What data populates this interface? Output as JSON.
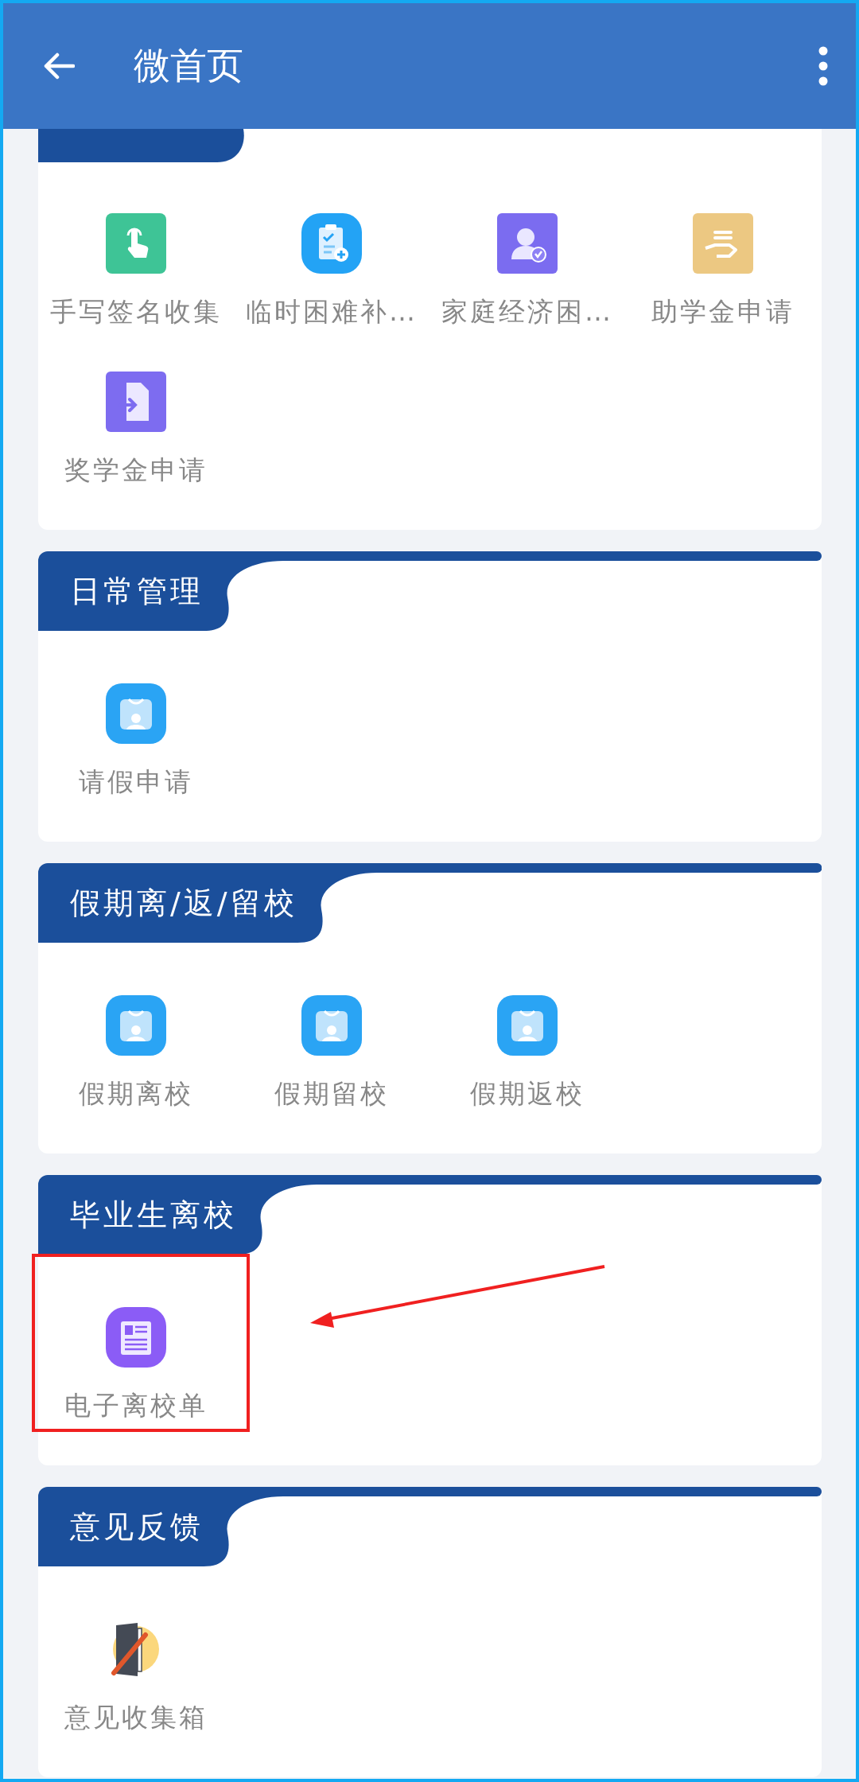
{
  "app_bar": {
    "title": "微首页"
  },
  "sections": [
    {
      "items": [
        {
          "label": "手写签名收集",
          "kind": "touch"
        },
        {
          "label": "临时困难补…",
          "kind": "clipboard"
        },
        {
          "label": "家庭经济困…",
          "kind": "user-check"
        },
        {
          "label": "助学金申请",
          "kind": "hand"
        },
        {
          "label": "奖学金申请",
          "kind": "file-arrow"
        }
      ]
    },
    {
      "title": "日常管理",
      "items": [
        {
          "label": "请假申请",
          "kind": "bag"
        }
      ]
    },
    {
      "title": "假期离/返/留校",
      "items": [
        {
          "label": "假期离校",
          "kind": "bag"
        },
        {
          "label": "假期留校",
          "kind": "bag"
        },
        {
          "label": "假期返校",
          "kind": "bag"
        }
      ]
    },
    {
      "title": "毕业生离校",
      "items": [
        {
          "label": "电子离校单",
          "kind": "news"
        }
      ]
    },
    {
      "title": "意见反馈",
      "items": [
        {
          "label": "意见收集箱",
          "kind": "notebook"
        }
      ]
    }
  ]
}
